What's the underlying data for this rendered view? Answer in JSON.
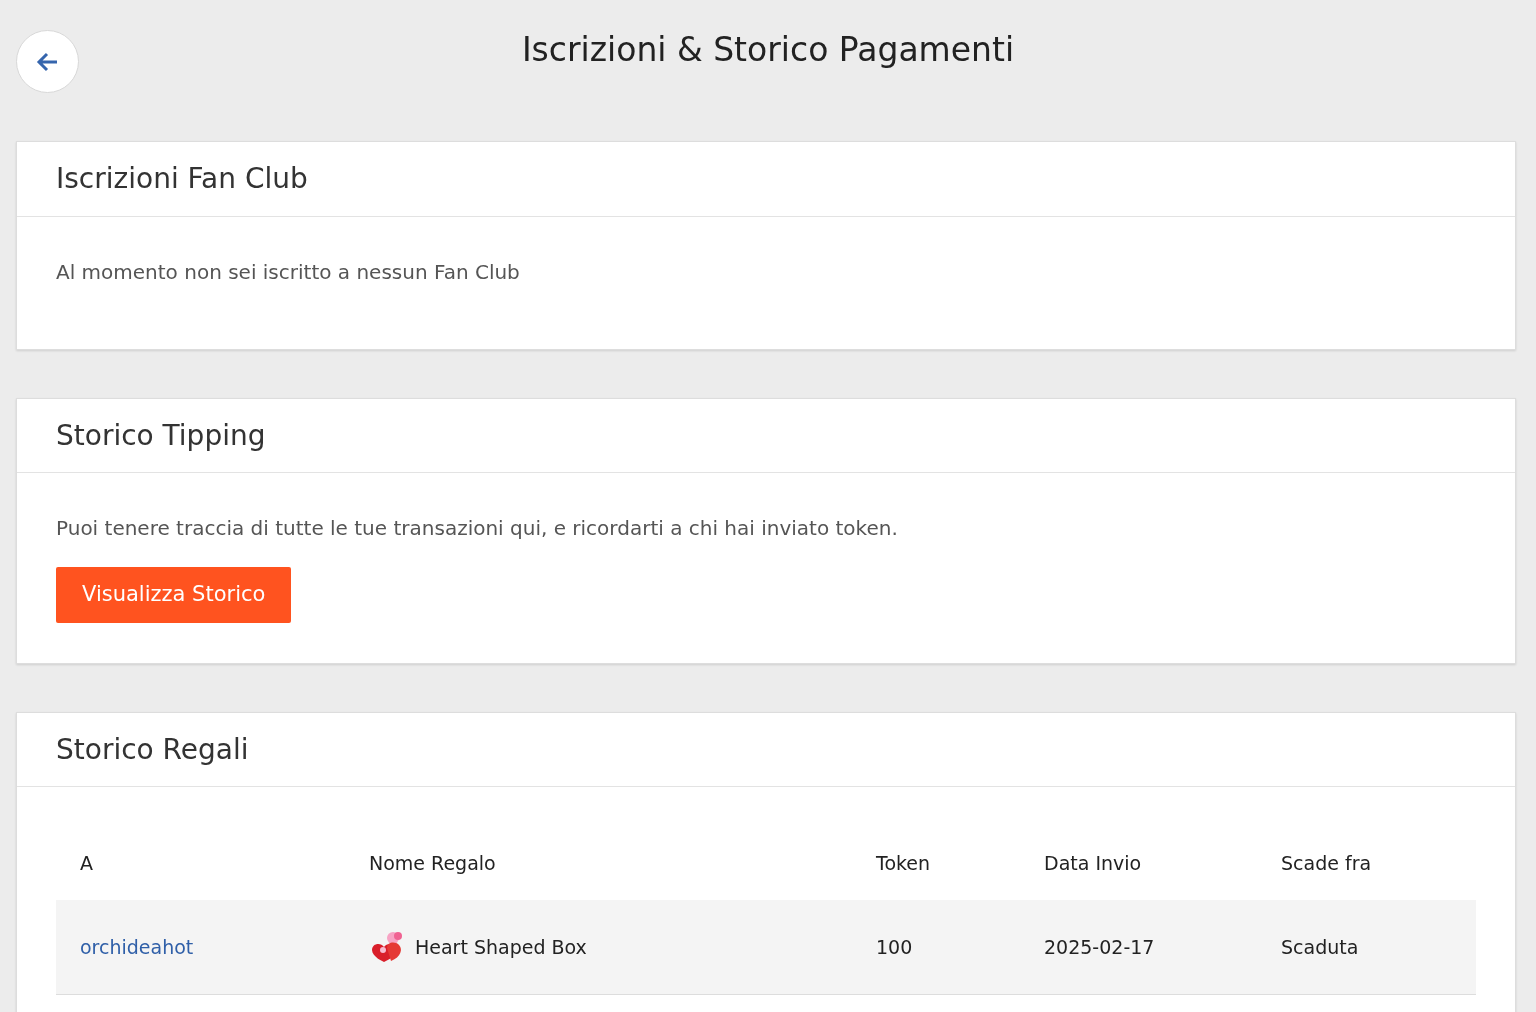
{
  "page": {
    "title": "Iscrizioni & Storico Pagamenti"
  },
  "fan_club": {
    "title": "Iscrizioni Fan Club",
    "message": "Al momento non sei iscritto a nessun Fan Club"
  },
  "tipping": {
    "title": "Storico Tipping",
    "message": "Puoi tenere traccia di tutte le tue transazioni qui, e ricordarti a chi hai inviato token.",
    "button": "Visualizza Storico"
  },
  "gifts": {
    "title": "Storico Regali",
    "columns": [
      "A",
      "Nome Regalo",
      "Token",
      "Data Invio",
      "Scade fra"
    ],
    "rows": [
      {
        "recipient": "orchideahot",
        "gift": "Heart Shaped Box",
        "tokens": "100",
        "sent": "2025-02-17",
        "expires": "Scaduta"
      }
    ]
  }
}
